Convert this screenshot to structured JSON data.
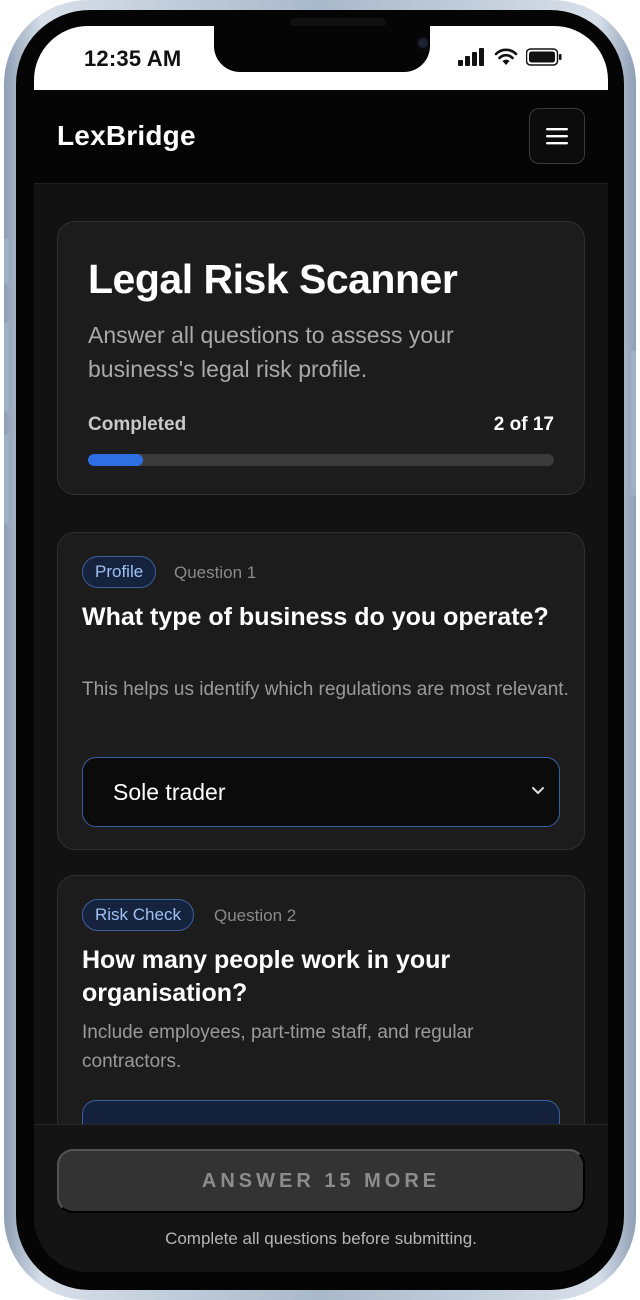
{
  "status_bar": {
    "time": "12:35 AM"
  },
  "header": {
    "brand": "LexBridge",
    "menu_icon": "hamburger-menu-icon"
  },
  "intro": {
    "title": "Legal Risk Scanner",
    "subtitle": "Answer all questions to assess your business's legal risk profile.",
    "progress_label": "Completed",
    "progress_count": "2 of 17",
    "progress_fraction": 0.1176
  },
  "questions": [
    {
      "category": "Profile",
      "number_label": "Question 1",
      "title": "What type of business do you operate?",
      "help": "This helps us identify which regulations are most relevant.",
      "selected_value": "Sole trader"
    },
    {
      "category": "Risk Check",
      "number_label": "Question 2",
      "title": "How many people work in your organisation?",
      "help": "Include employees, part-time staff, and regular contractors."
    }
  ],
  "footer": {
    "submit_label": "ANSWER 15 MORE",
    "note": "Complete all questions before submitting."
  },
  "colors": {
    "accent": "#2f6fe4",
    "badge_text": "#9fc0f2",
    "background": "#121212"
  }
}
